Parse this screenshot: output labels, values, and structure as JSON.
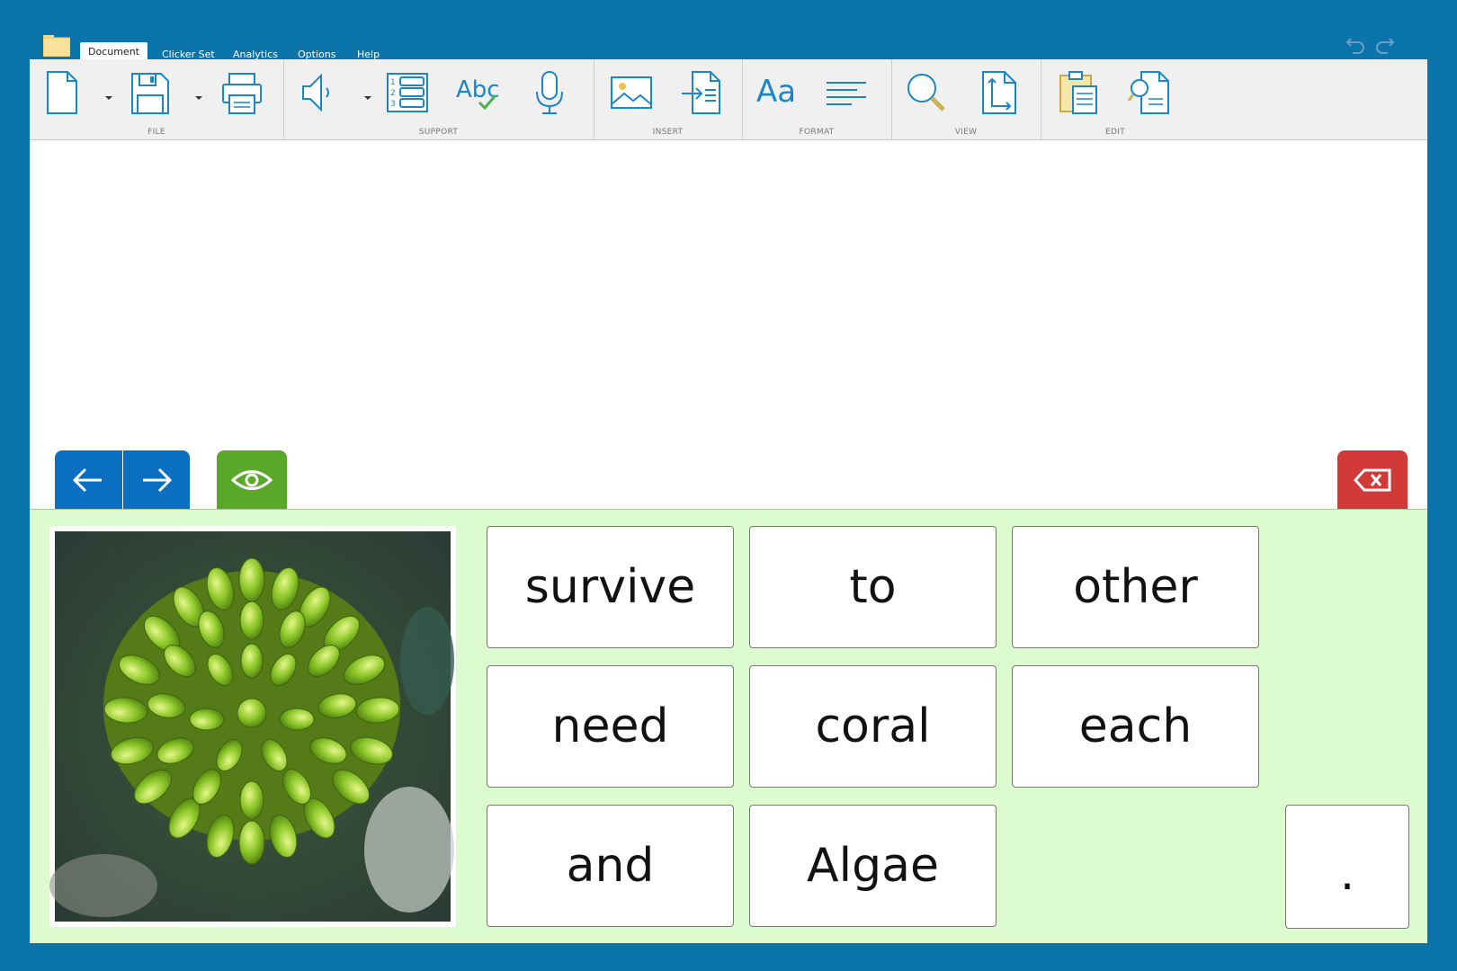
{
  "menu": {
    "tabs": [
      "Document",
      "Clicker Set",
      "Analytics",
      "Options",
      "Help"
    ],
    "active": "Document"
  },
  "ribbon": {
    "groups": {
      "file": "FILE",
      "support": "SUPPORT",
      "insert": "INSERT",
      "format": "FORMAT",
      "view": "VIEW",
      "edit": "EDIT"
    },
    "format_font_label": "Aa",
    "spellcheck_label": "Abc"
  },
  "grid": {
    "words": [
      "survive",
      "to",
      "other",
      "need",
      "coral",
      "each",
      "and",
      "Algae"
    ],
    "punctuation": "."
  },
  "colors": {
    "frame": "#0b74aa",
    "panel": "#dcfcd0",
    "nav_blue": "#0a6fc0",
    "eye_green": "#5aa82a",
    "delete_red": "#d23a3a"
  }
}
